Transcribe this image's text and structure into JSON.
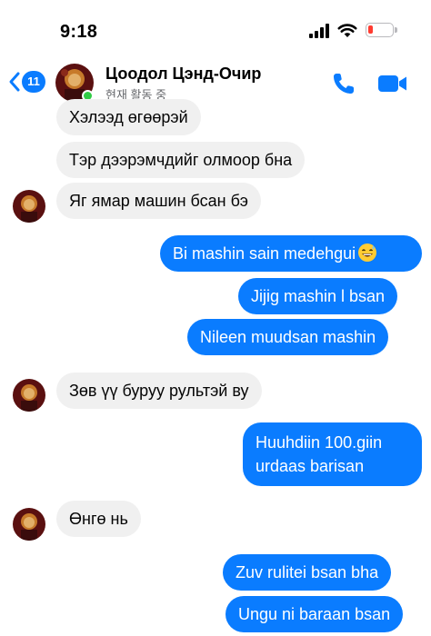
{
  "status_bar": {
    "time": "9:18",
    "battery_color": "#ff3b30"
  },
  "header": {
    "unread_count": "11",
    "contact_name": "Цоодол Цэнд-Очир",
    "status": "현재 활동 중",
    "icons": [
      "back-chevron-icon",
      "avatar",
      "phone-icon",
      "video-camera-icon"
    ],
    "accent_color": "#0a7cff"
  },
  "messages": [
    {
      "side": "in",
      "text": "Хэлээд өгөөрэй"
    },
    {
      "side": "in",
      "text": "Тэр дээрэмчдийг олмоор бна"
    },
    {
      "side": "in",
      "text": "Яг ямар машин бсан бэ"
    },
    {
      "side": "out",
      "text": "Bi mashin  sain medehgui",
      "emoji": "grinning-sweat-emoji"
    },
    {
      "side": "out",
      "text": "Jijig mashin  l bsan"
    },
    {
      "side": "out",
      "text": "Nileen  muudsan  mashin"
    },
    {
      "side": "in",
      "text": "Зөв үү буруу рультэй ву"
    },
    {
      "side": "out",
      "text": "Huuhdiin 100.giin urdaas  barisan"
    },
    {
      "side": "in",
      "text": "Өнгө нь"
    },
    {
      "side": "out",
      "text": "Zuv  rulitei  bsan bha"
    },
    {
      "side": "out",
      "text": "Ungu ni baraan bsan"
    }
  ],
  "colors": {
    "incoming_bubble": "#f0f0f0",
    "outgoing_bubble": "#0a7cff"
  }
}
